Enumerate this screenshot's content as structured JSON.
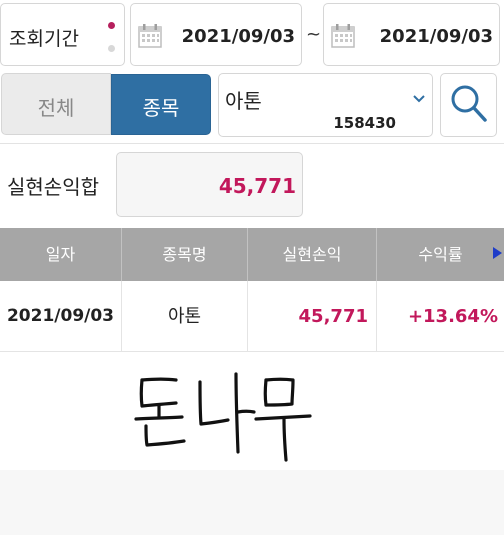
{
  "filters": {
    "period_label": "조회기간",
    "date_start": "2021/09/03",
    "date_separator": "~",
    "date_end": "2021/09/03"
  },
  "mode": {
    "all_label": "전체",
    "item_label": "종목",
    "selected": "종목"
  },
  "stock": {
    "name": "아톤",
    "code": "158430"
  },
  "summary": {
    "realized_pnl_label": "실현손익합",
    "realized_pnl_value": "45,771"
  },
  "table": {
    "columns": [
      "일자",
      "종목명",
      "실현손익",
      "수익률"
    ],
    "rows": [
      {
        "date": "2021/09/03",
        "name": "아톤",
        "pnl": "45,771",
        "rate": "+13.64%"
      }
    ]
  },
  "signature": "돈나무",
  "colors": {
    "accent_blue": "#2f6fa3",
    "profit_red": "#c2185b",
    "header_gray": "#a6a6a6",
    "dot_active": "#b6205d"
  },
  "icons": [
    "calendar-icon",
    "chevron-down-icon",
    "search-icon",
    "scroll-right-arrow-icon"
  ]
}
